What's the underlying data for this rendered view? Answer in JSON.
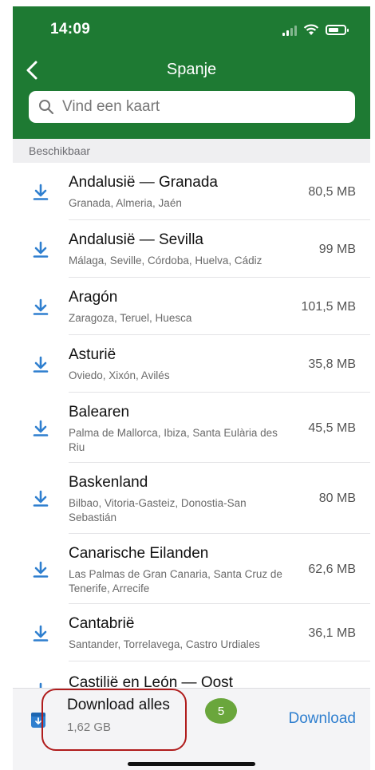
{
  "status": {
    "time": "14:09"
  },
  "header": {
    "title": "Spanje",
    "search_placeholder": "Vind een kaart"
  },
  "section_label": "Beschikbaar",
  "regions": [
    {
      "name": "Andalusië — Granada",
      "cities": "Granada, Almeria, Jaén",
      "size": "80,5 MB"
    },
    {
      "name": "Andalusië — Sevilla",
      "cities": "Málaga, Seville, Córdoba, Huelva, Cádiz",
      "size": "99 MB"
    },
    {
      "name": "Aragón",
      "cities": "Zaragoza, Teruel, Huesca",
      "size": "101,5 MB"
    },
    {
      "name": "Asturië",
      "cities": "Oviedo, Xixón, Avilés",
      "size": "35,8 MB"
    },
    {
      "name": "Balearen",
      "cities": "Palma de Mallorca, Ibiza, Santa Eulària des Riu",
      "size": "45,5 MB"
    },
    {
      "name": "Baskenland",
      "cities": "Bilbao, Vitoria-Gasteiz, Donostia-San Sebastián",
      "size": "80 MB"
    },
    {
      "name": "Canarische Eilanden",
      "cities": "Las Palmas de Gran Canaria, Santa Cruz de Tenerife, Arrecife",
      "size": "62,6 MB"
    },
    {
      "name": "Cantabrië",
      "cities": "Santander, Torrelavega, Castro Urdiales",
      "size": "36,1 MB"
    },
    {
      "name": "Castilië en León — Oost",
      "cities": "",
      "size": ""
    }
  ],
  "bottom_bar": {
    "label": "Download alles",
    "size": "1,62 GB",
    "badge": "5",
    "button": "Download"
  },
  "colors": {
    "header": "#1e7a33",
    "accent": "#2f7fcf",
    "highlight": "#b01c1c",
    "badge": "#6aa63c"
  },
  "icons": {
    "back": "chevron-left-icon",
    "search": "search-icon",
    "row": "download-arrow-icon",
    "bottom": "box-icon"
  }
}
